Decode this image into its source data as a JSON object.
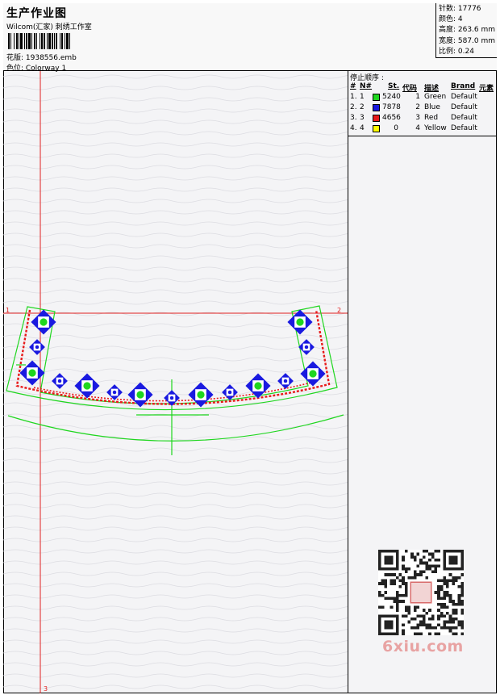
{
  "header": {
    "title": "生产作业图",
    "company": "Wilcom(汇家) 刺绣工作室",
    "design_label": "花版: 1938556.emb",
    "colorway_label": "色位:  Colorway 1"
  },
  "stats": {
    "stitches": "针数: 17776",
    "colors": "颜色: 4",
    "height": "高度: 263.6 mm",
    "width": "宽度: 587.0 mm",
    "scale": "比例: 0.24"
  },
  "stop_sequence": {
    "title": "停止顺序 :",
    "columns": [
      "#",
      "N#",
      "St.",
      "代码",
      "描述",
      "Brand",
      "元素"
    ],
    "rows": [
      {
        "index": "1.",
        "needle": "1",
        "color": "#1fd61f",
        "stitches": "5240",
        "code": "1",
        "desc": "Green",
        "brand": "Default"
      },
      {
        "index": "2.",
        "needle": "2",
        "color": "#1a1ae0",
        "stitches": "7878",
        "code": "2",
        "desc": "Blue",
        "brand": "Default"
      },
      {
        "index": "3.",
        "needle": "3",
        "color": "#e81a1a",
        "stitches": "4656",
        "code": "3",
        "desc": "Red",
        "brand": "Default"
      },
      {
        "index": "4.",
        "needle": "4",
        "color": "#ffff00",
        "stitches": "0",
        "code": "4",
        "desc": "Yellow",
        "brand": "Default"
      }
    ]
  },
  "canvas": {
    "guide_label_1": "1",
    "guide_label_2": "2",
    "guide_label_3": "3"
  },
  "watermark": "6xiu.com"
}
